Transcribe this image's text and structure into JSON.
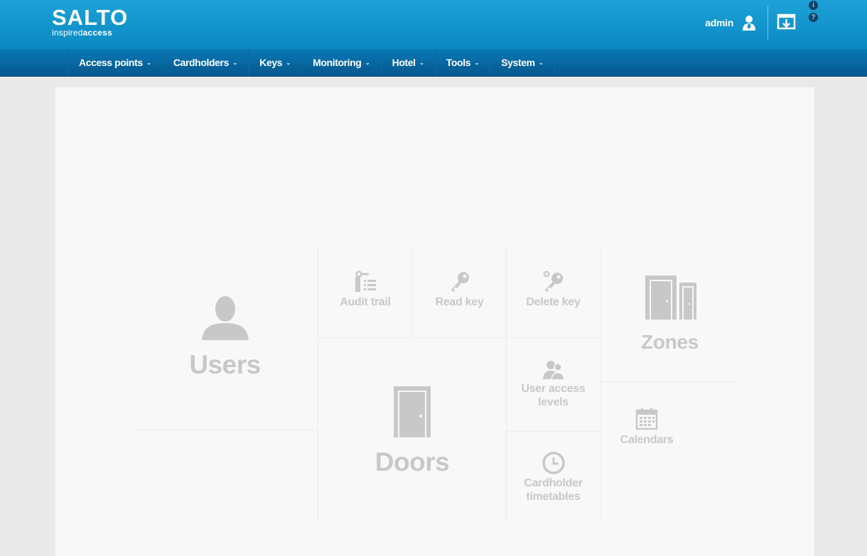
{
  "header": {
    "logo_main": "SALTO",
    "logo_sub_light": "inspired",
    "logo_sub_bold": "access",
    "user_name": "admin",
    "icons": [
      "user-icon",
      "logout-icon",
      "info-icon",
      "help-icon"
    ]
  },
  "nav": {
    "items": [
      {
        "label": "Access points"
      },
      {
        "label": "Cardholders"
      },
      {
        "label": "Keys"
      },
      {
        "label": "Monitoring"
      },
      {
        "label": "Hotel"
      },
      {
        "label": "Tools"
      },
      {
        "label": "System"
      }
    ],
    "caret": "⌄"
  },
  "tiles": {
    "users": "Users",
    "audit_trail": "Audit trail",
    "read_key": "Read key",
    "delete_key": "Delete key",
    "zones": "Zones",
    "doors": "Doors",
    "user_access_levels_1": "User access",
    "user_access_levels_2": "levels",
    "calendars": "Calendars",
    "cardholder_timetables_1": "Cardholder",
    "cardholder_timetables_2": "timetables"
  },
  "colors": {
    "header_top": "#1da2d8",
    "header_bottom": "#0a88c2",
    "nav": "#05578d",
    "tile_text": "#c8c8c8",
    "panel": "#f8f8f8",
    "background": "#e9e9e9"
  }
}
